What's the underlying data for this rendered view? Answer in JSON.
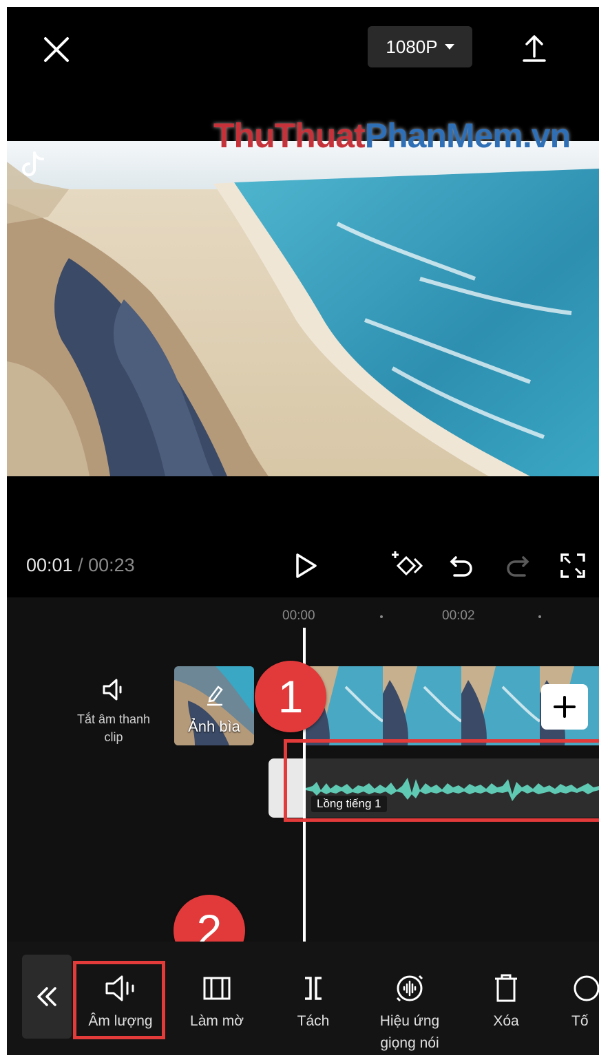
{
  "header": {
    "resolution_label": "1080P",
    "watermark_part1": "ThuThuat",
    "watermark_part2": "PhanMem.vn"
  },
  "player": {
    "current_time": "00:01",
    "separator": " / ",
    "total_time": "00:23"
  },
  "timeline": {
    "ruler": [
      "00:00",
      "00:02"
    ],
    "mute_label": "Tắt âm thanh clip",
    "cover_label": "Ảnh bìa",
    "audio_label": "Lồng tiếng 1"
  },
  "annotations": {
    "badge1": "1",
    "badge2": "2"
  },
  "toolbar": {
    "items": [
      {
        "label": "Âm lượng",
        "icon": "volume-icon"
      },
      {
        "label": "Làm mờ",
        "icon": "fade-icon"
      },
      {
        "label": "Tách",
        "icon": "split-icon"
      },
      {
        "label": "Hiệu ứng giọng nói",
        "icon": "voice-effect-icon"
      },
      {
        "label": "Xóa",
        "icon": "trash-icon"
      },
      {
        "label": "Tố",
        "icon": "speed-icon"
      }
    ]
  },
  "colors": {
    "background": "#000000",
    "annotation_red": "#e33a3a",
    "waveform": "#5fc9b4"
  }
}
